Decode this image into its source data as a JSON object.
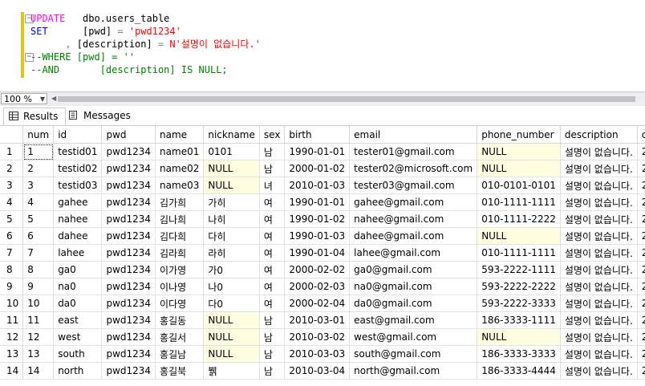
{
  "editor": {
    "l1": {
      "kw": "UPDATE",
      "rest": "   dbo.users_table"
    },
    "l2": {
      "kw": "SET",
      "p1": "      [pwd] ",
      "eq": "=",
      "sp": " ",
      "str": "'pwd1234'"
    },
    "l3": {
      "comma": "      , ",
      "p1": "[description] ",
      "eq": "=",
      "sp": " ",
      "str": "N'설명이 없습니다.'"
    },
    "l4": {
      "c1": "--WHERE [pwd] ",
      "eq": "=",
      "c2": " ''"
    },
    "l5": {
      "c1": "--AND       [description] IS NULL;"
    },
    "fold_symbol": "−"
  },
  "zoom": {
    "value": "100 %",
    "dropdown_icon": "chevron-down-icon"
  },
  "tabs": {
    "results": "Results",
    "messages": "Messages"
  },
  "columns": [
    "num",
    "id",
    "pwd",
    "name",
    "nickname",
    "sex",
    "birth",
    "email",
    "phone_number",
    "description",
    "c"
  ],
  "rows": [
    [
      "1",
      "1",
      "testid01",
      "pwd1234",
      "name01",
      "0101",
      "남",
      "1990-01-01",
      "tester01@gmail.com",
      "NULL",
      "설명이 없습니다.",
      "2"
    ],
    [
      "2",
      "2",
      "testid02",
      "pwd1234",
      "name02",
      "NULL",
      "남",
      "2000-01-02",
      "tester02@microsoft.com",
      "NULL",
      "설명이 없습니다.",
      "2"
    ],
    [
      "3",
      "3",
      "testid03",
      "pwd1234",
      "name03",
      "NULL",
      "녀",
      "2010-01-03",
      "tester03@gmail.com",
      "010-0101-0101",
      "설명이 없습니다.",
      "2"
    ],
    [
      "4",
      "4",
      "gahee",
      "pwd1234",
      "김가희",
      "가히",
      "여",
      "1990-01-01",
      "gahee@gmail.com",
      "010-1111-1111",
      "설명이 없습니다.",
      "2"
    ],
    [
      "5",
      "5",
      "nahee",
      "pwd1234",
      "김나희",
      "나히",
      "여",
      "1990-01-02",
      "nahee@gmail.com",
      "010-1111-2222",
      "설명이 없습니다.",
      "2"
    ],
    [
      "6",
      "6",
      "dahee",
      "pwd1234",
      "김다희",
      "다히",
      "여",
      "1990-01-03",
      "dahee@gmail.com",
      "NULL",
      "설명이 없습니다.",
      "2"
    ],
    [
      "7",
      "7",
      "lahee",
      "pwd1234",
      "김라희",
      "라히",
      "여",
      "1990-01-04",
      "lahee@gmail.com",
      "010-1111-1111",
      "설명이 없습니다.",
      "2"
    ],
    [
      "8",
      "8",
      "ga0",
      "pwd1234",
      "이가영",
      "가0",
      "여",
      "2000-02-02",
      "ga0@gmail.com",
      "593-2222-1111",
      "설명이 없습니다.",
      "2"
    ],
    [
      "9",
      "9",
      "na0",
      "pwd1234",
      "이나영",
      "나0",
      "여",
      "2000-02-03",
      "na0@gmail.com",
      "593-2222-2222",
      "설명이 없습니다.",
      "2"
    ],
    [
      "10",
      "10",
      "da0",
      "pwd1234",
      "이다영",
      "다0",
      "여",
      "2000-02-04",
      "da0@gmail.com",
      "593-2222-3333",
      "설명이 없습니다.",
      "2"
    ],
    [
      "11",
      "11",
      "east",
      "pwd1234",
      "홍길동",
      "NULL",
      "남",
      "2010-03-01",
      "east@gmail.com",
      "186-3333-1111",
      "설명이 없습니다.",
      "2"
    ],
    [
      "12",
      "12",
      "west",
      "pwd1234",
      "홍길서",
      "NULL",
      "남",
      "2010-03-02",
      "west@gmail.com",
      "NULL",
      "설명이 없습니다.",
      "2"
    ],
    [
      "13",
      "13",
      "south",
      "pwd1234",
      "홍길남",
      "NULL",
      "남",
      "2010-03-03",
      "south@gmail.com",
      "186-3333-3333",
      "설명이 없습니다.",
      "2"
    ],
    [
      "14",
      "14",
      "north",
      "pwd1234",
      "홍길북",
      "뷁",
      "남",
      "2010-03-04",
      "north@gmail.com",
      "186-3333-4444",
      "설명이 없습니다.",
      "2"
    ]
  ],
  "colors": {
    "null_bg": "#fffde0",
    "keyword": "#0000ff",
    "string": "#ff0000",
    "comment": "#008000",
    "change_bar": "#e5c700"
  }
}
